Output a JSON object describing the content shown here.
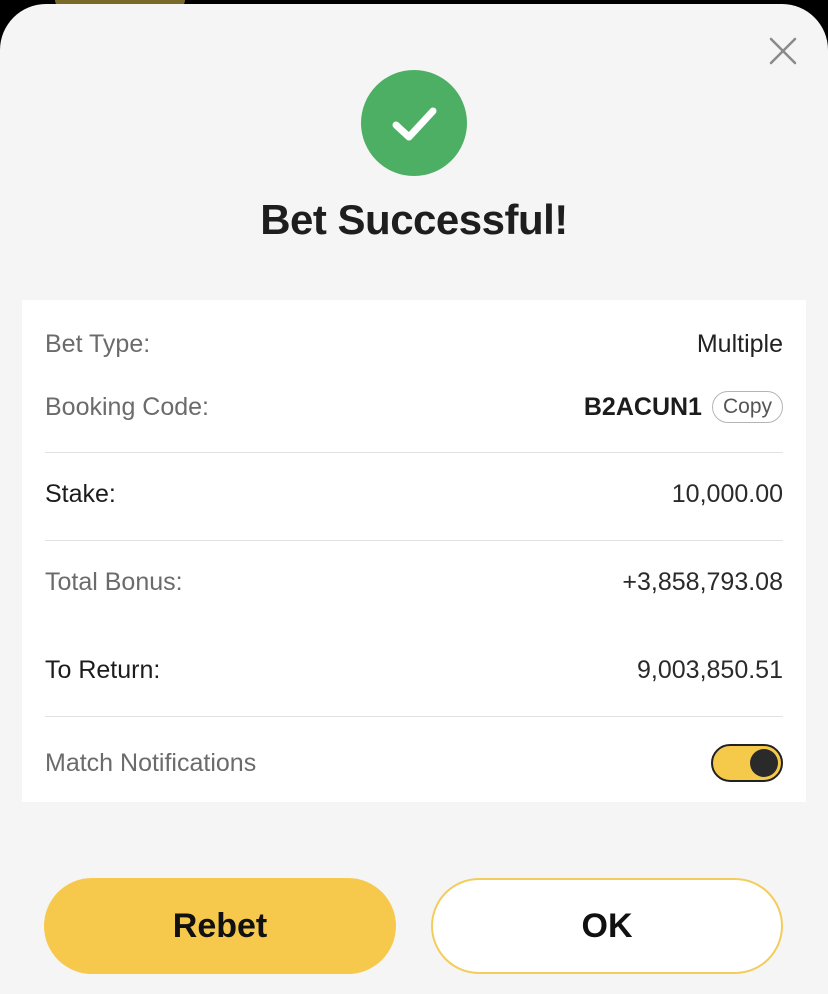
{
  "dialog": {
    "title": "Bet Successful!"
  },
  "details": {
    "bet_type": {
      "label": "Bet Type:",
      "value": "Multiple"
    },
    "booking_code": {
      "label": "Booking Code:",
      "value": "B2ACUN1",
      "copy_label": "Copy"
    },
    "stake": {
      "label": "Stake:",
      "value": "10,000.00"
    },
    "total_bonus": {
      "label": "Total Bonus:",
      "value": "+3,858,793.08"
    },
    "to_return": {
      "label": "To Return:",
      "value": "9,003,850.51"
    },
    "match_notifications": {
      "label": "Match Notifications",
      "enabled": true
    }
  },
  "actions": {
    "rebet_label": "Rebet",
    "ok_label": "OK"
  },
  "colors": {
    "success_green": "#4caf63",
    "accent_yellow": "#f6c94d"
  }
}
